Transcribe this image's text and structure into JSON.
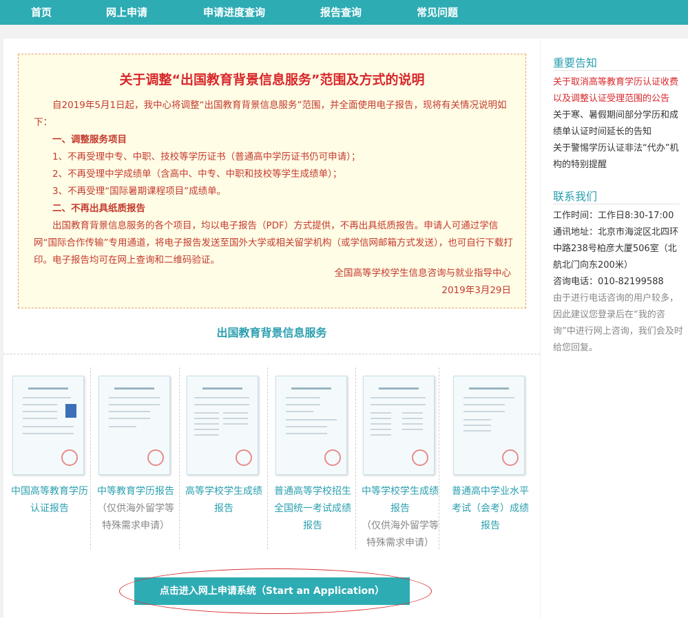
{
  "nav": {
    "items": [
      "首页",
      "网上申请",
      "申请进度查询",
      "报告查询",
      "常见问题"
    ]
  },
  "notice": {
    "title": "关于调整“出国教育背景信息服务”范围及方式的说明",
    "intro": "自2019年5月1日起，我中心将调整“出国教育背景信息服务”范围，并全面使用电子报告，现将有关情况说明如下：",
    "section1": "一、调整服务项目",
    "item1": "1、不再受理中专、中职、技校等学历证书（普通高中学历证书仍可申请）；",
    "item2": "2、不再受理中学成绩单（含高中、中专、中职和技校等学生成绩单）；",
    "item3": "3、不再受理“国际暑期课程项目”成绩单。",
    "section2": "二、不再出具纸质报告",
    "para2": "出国教育背景信息服务的各个项目，均以电子报告（PDF）方式提供，不再出具纸质报告。申请人可通过学信网“国际合作传输”专用通道，将电子报告发送至国外大学或相关留学机构（或学信网邮箱方式发送），也可自行下载打印。电子报告均可在网上查询和二维码验证。",
    "signature": "全国高等学校学生信息咨询与就业指导中心",
    "date": "2019年3月29日"
  },
  "services": {
    "title": "出国教育背景信息服务",
    "reports": [
      {
        "name": "中国高等教育学历认证报告",
        "note": ""
      },
      {
        "name": "中等教育学历报告",
        "note": "（仅供海外留学等特殊需求申请）"
      },
      {
        "name": "高等学校学生成绩报告",
        "note": ""
      },
      {
        "name": "普通高等学校招生全国统一考试成绩报告",
        "note": ""
      },
      {
        "name": "中等学校学生成绩报告",
        "note": "（仅供海外留学等特殊需求申请）"
      },
      {
        "name": "普通高中学业水平考试（会考）成绩报告",
        "note": ""
      }
    ],
    "apply_button": "点击进入网上申请系统（Start an Application）"
  },
  "sidebar": {
    "notices_title": "重要告知",
    "notices": [
      "关于取消高等教育学历认证收费以及调整认证受理范围的公告",
      "关于寒、暑假期间部分学历和成绩单认证时间延长的告知",
      "关于警惕学历认证非法“代办”机构的特别提醒"
    ],
    "contact_title": "联系我们",
    "hours": "工作时间：工作日8:30-17:00",
    "address": "通讯地址：北京市海淀区北四环中路238号柏彦大厦506室（北航北门向东200米）",
    "phone": "咨询电话：010-82199588",
    "note": "由于进行电话咨询的用户较多，因此建议您登录后在“我的咨询”中进行网上咨询，我们会及时给您回复。"
  },
  "colors": {
    "nav": "#2eacb4",
    "accent": "#2a9faf",
    "notice_text": "#c43a2e",
    "notice_bg": "#fffde6",
    "alert_link": "#d8262a"
  },
  "icons": {
    "report_thumbnail": "document-icon"
  }
}
